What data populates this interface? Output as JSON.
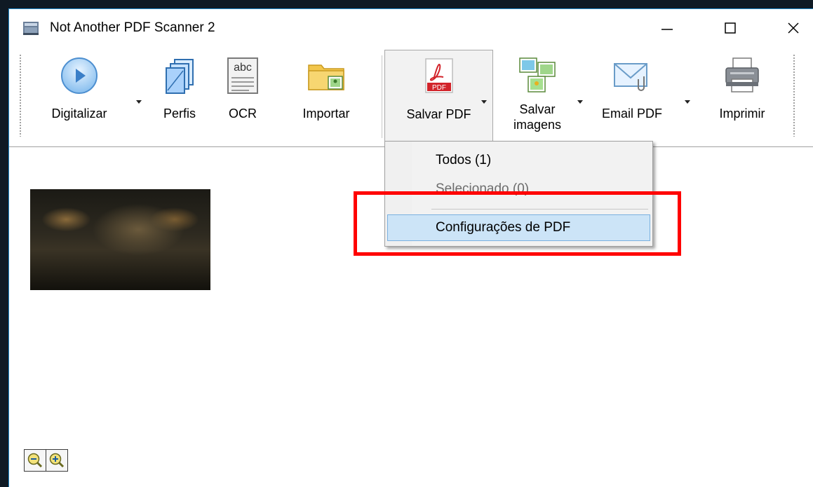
{
  "window": {
    "title": "Not Another PDF Scanner 2",
    "controls": {
      "minimize": "—",
      "maximize": "☐",
      "close": "✕"
    }
  },
  "toolbar": {
    "scan": {
      "label": "Digitalizar",
      "icon": "play-icon"
    },
    "profiles": {
      "label": "Perfis",
      "icon": "profiles-icon"
    },
    "ocr": {
      "label": "OCR",
      "icon": "ocr-icon",
      "icon_text": "abc"
    },
    "import": {
      "label": "Importar",
      "icon": "folder-icon"
    },
    "save_pdf": {
      "label": "Salvar PDF",
      "icon": "pdf-icon",
      "icon_text": "PDF"
    },
    "save_images": {
      "label_line1": "Salvar",
      "label_line2": "imagens",
      "icon": "images-icon"
    },
    "email_pdf": {
      "label": "Email PDF",
      "icon": "email-icon"
    },
    "print": {
      "label": "Imprimir",
      "icon": "printer-icon"
    }
  },
  "save_pdf_menu": {
    "items": [
      {
        "label": "Todos (1)",
        "enabled": true
      },
      {
        "label": "Selecionado (0)",
        "enabled": false
      },
      {
        "label": "Configurações de PDF",
        "enabled": true,
        "highlighted": true
      }
    ]
  },
  "zoom": {
    "zoom_out": "zoom-out-icon",
    "zoom_in": "zoom-in-icon"
  },
  "colors": {
    "accent_blue": "#1e88c8",
    "menu_highlight": "#cce4f7",
    "annotation_red": "#ff0000"
  }
}
